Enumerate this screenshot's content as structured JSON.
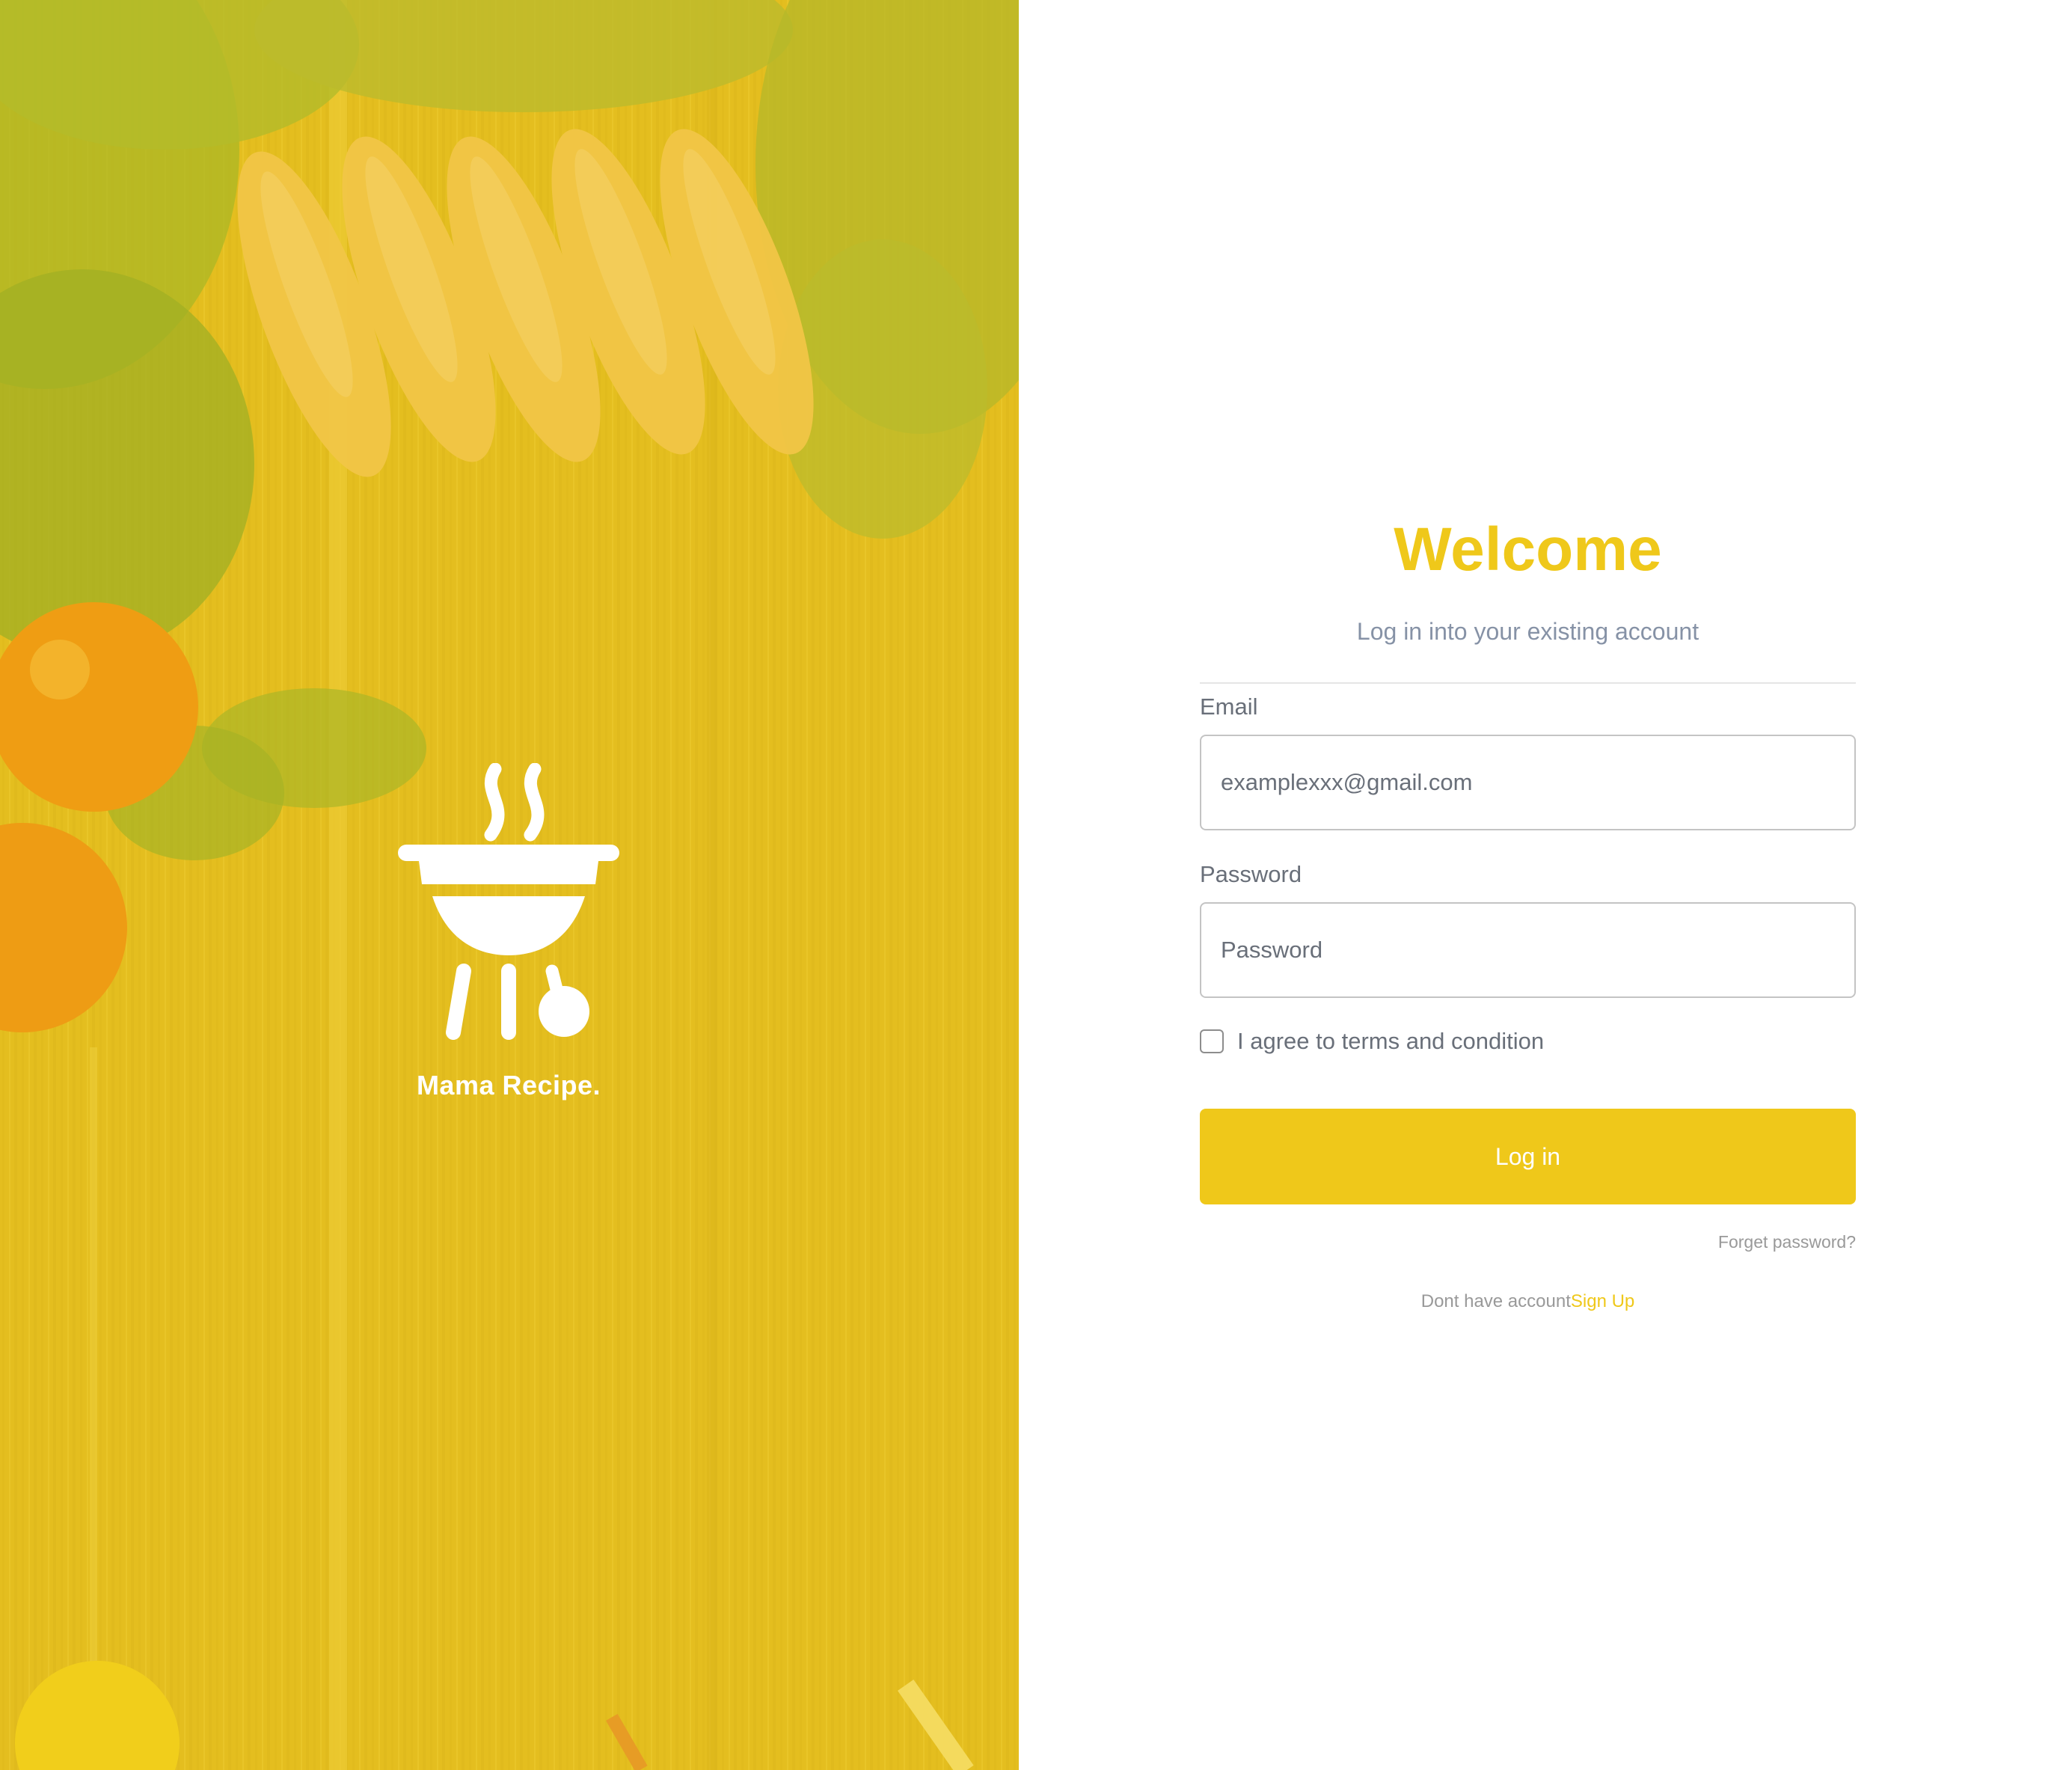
{
  "brand": {
    "name": "Mama Recipe.",
    "logo_icon": "grill-icon"
  },
  "colors": {
    "accent": "#EFC81A",
    "muted_text": "#8692A6",
    "label_text": "#696F79",
    "link_gray": "#999999"
  },
  "login": {
    "title": "Welcome",
    "subtitle": "Log in into your existing account",
    "email": {
      "label": "Email",
      "placeholder": "examplexxx@gmail.com",
      "value": ""
    },
    "password": {
      "label": "Password",
      "placeholder": "Password",
      "value": ""
    },
    "terms": {
      "label": "I agree to terms and condition",
      "checked": false
    },
    "submit_label": "Log in",
    "forgot_label": "Forget password?",
    "signup_prompt": "Dont have account",
    "signup_link": "Sign Up"
  }
}
